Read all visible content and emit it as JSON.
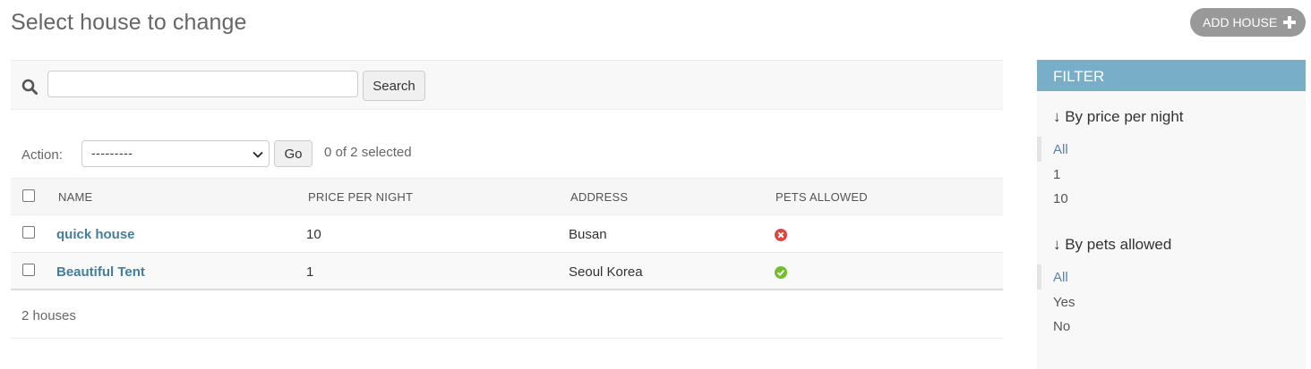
{
  "header": {
    "title": "Select house to change",
    "add_button_label": "ADD HOUSE"
  },
  "search": {
    "value": "",
    "placeholder": "",
    "button_label": "Search"
  },
  "actions": {
    "label": "Action:",
    "selected_option": "---------",
    "go_label": "Go",
    "selected_count": "0 of 2 selected"
  },
  "table": {
    "columns": [
      "NAME",
      "PRICE PER NIGHT",
      "ADDRESS",
      "PETS ALLOWED"
    ],
    "rows": [
      {
        "name": "quick house",
        "price": "10",
        "address": "Busan",
        "pets_allowed": "no-icon"
      },
      {
        "name": "Beautiful Tent",
        "price": "1",
        "address": "Seoul Korea",
        "pets_allowed": "yes-icon"
      }
    ]
  },
  "paginator": {
    "text": "2 houses"
  },
  "filter": {
    "title": "FILTER",
    "groups": [
      {
        "title": "↓ By price per night",
        "items": [
          "All",
          "1",
          "10"
        ],
        "selected": "All"
      },
      {
        "title": "↓ By pets allowed",
        "items": [
          "All",
          "Yes",
          "No"
        ],
        "selected": "All"
      }
    ]
  },
  "colors": {
    "link": "#447e9b",
    "filter_header": "#79aec8",
    "add_button": "#999999",
    "yes": "#70bf2b",
    "no": "#dd4646"
  }
}
